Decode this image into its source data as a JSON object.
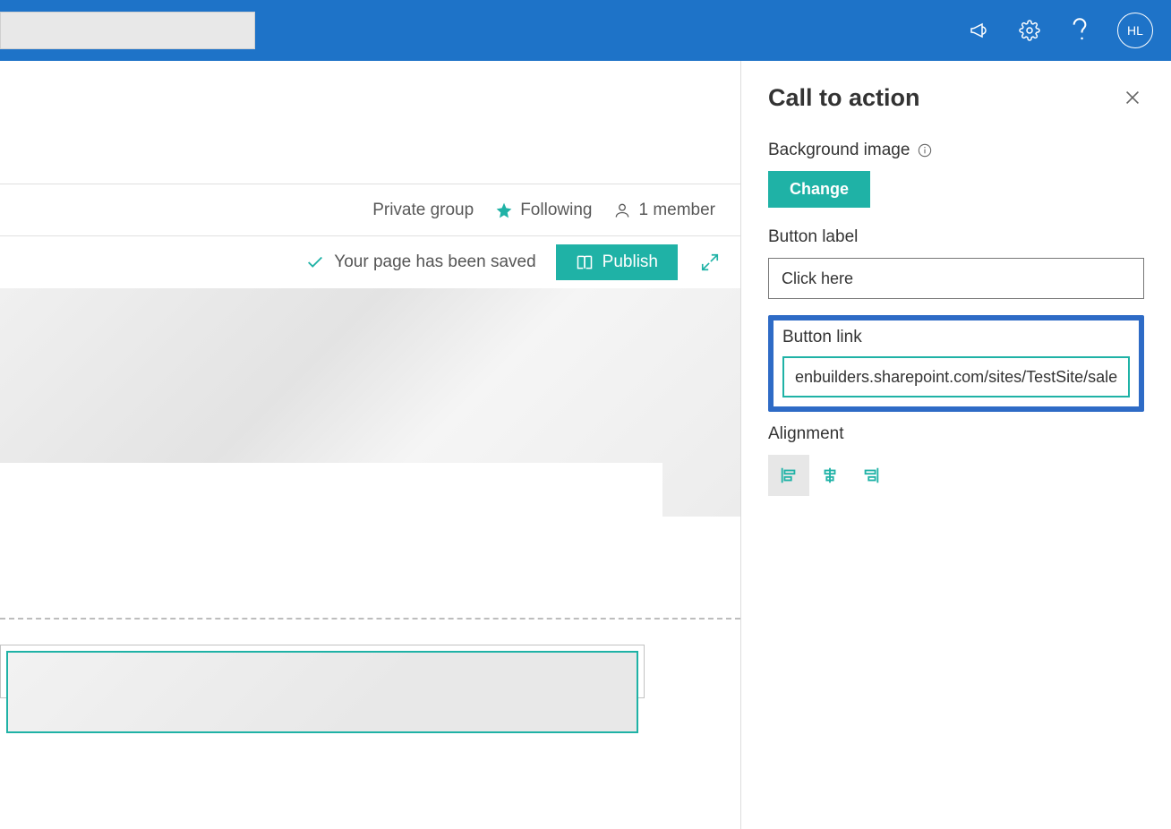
{
  "topbar": {
    "avatar_initials": "HL"
  },
  "status": {
    "group_type": "Private group",
    "following": "Following",
    "members": "1 member"
  },
  "save": {
    "message": "Your page has been saved",
    "publish_label": "Publish"
  },
  "panel": {
    "title": "Call to action",
    "bg_label": "Background image",
    "change_label": "Change",
    "button_label_label": "Button label",
    "button_label_value": "Click here",
    "button_link_label": "Button link",
    "button_link_value": "enbuilders.sharepoint.com/sites/TestSite/sales",
    "alignment_label": "Alignment"
  }
}
